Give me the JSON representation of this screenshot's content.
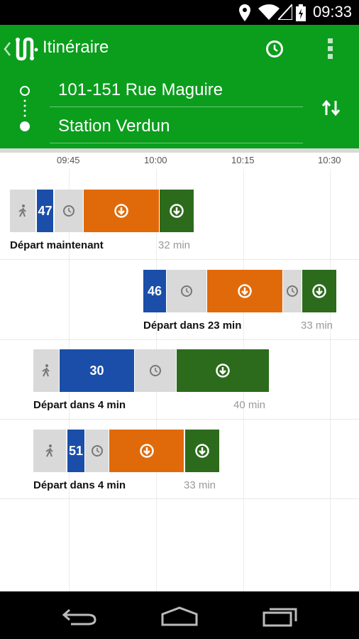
{
  "status": {
    "time": "09:33"
  },
  "header": {
    "title": "Itinéraire",
    "from": "101-151 Rue Maguire",
    "to": "Station Verdun"
  },
  "timeline": {
    "ticks": [
      "09:45",
      "10:00",
      "10:15",
      "10:30"
    ]
  },
  "routes": [
    {
      "bus": "47",
      "depart": "Départ maintenant",
      "duration": "32 min"
    },
    {
      "bus": "46",
      "depart": "Départ dans 23 min",
      "duration": "33 min"
    },
    {
      "bus": "30",
      "depart": "Départ dans 4 min",
      "duration": "40 min"
    },
    {
      "bus": "51",
      "depart": "Départ dans 4 min",
      "duration": "33 min"
    }
  ],
  "colors": {
    "header": "#0a9e1c",
    "bus": "#1a4ea8",
    "metro_orange": "#e06a0a",
    "metro_green": "#2c6b1c",
    "wait": "#d9d9d9"
  },
  "icons": {
    "back": "chevron-left-icon",
    "logo": "transit-logo-icon",
    "clock": "clock-icon",
    "menu": "overflow-menu-icon",
    "swap": "swap-icon",
    "walk": "walk-icon",
    "metro": "metro-icon"
  }
}
